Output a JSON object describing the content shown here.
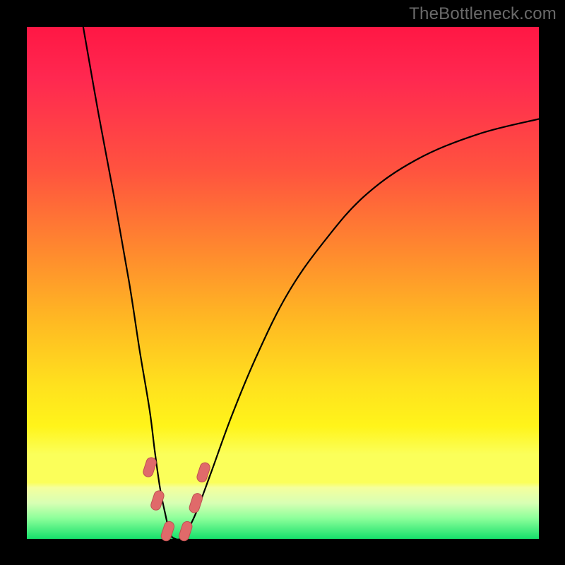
{
  "watermark": "TheBottleneck.com",
  "chart_data": {
    "type": "line",
    "title": "",
    "xlabel": "",
    "ylabel": "",
    "xlim": [
      0,
      100
    ],
    "ylim": [
      0,
      100
    ],
    "grid": false,
    "legend": false,
    "background": "red-yellow-green vertical gradient",
    "series": [
      {
        "name": "bottleneck-curve",
        "x": [
          11,
          14,
          17,
          20,
          22,
          24,
          25,
          26,
          27,
          28,
          29,
          30,
          31,
          33,
          36,
          40,
          45,
          51,
          58,
          66,
          76,
          88,
          100
        ],
        "y": [
          100,
          83,
          67,
          50,
          37,
          25,
          17,
          10,
          5,
          1,
          0,
          0,
          1,
          5,
          13,
          24,
          36,
          48,
          58,
          67,
          74,
          79,
          82
        ]
      }
    ],
    "annotations": [
      {
        "name": "nodule",
        "x": 24.0,
        "y": 14.0
      },
      {
        "name": "nodule",
        "x": 25.5,
        "y": 7.5
      },
      {
        "name": "nodule",
        "x": 27.5,
        "y": 1.5
      },
      {
        "name": "nodule",
        "x": 31.0,
        "y": 1.5
      },
      {
        "name": "nodule",
        "x": 33.0,
        "y": 7.0
      },
      {
        "name": "nodule",
        "x": 34.5,
        "y": 13.0
      }
    ],
    "colors": {
      "curve": "#000000",
      "nodule_fill": "#e06a6a",
      "gradient_top": "#ff1744",
      "gradient_mid": "#ffe11e",
      "gradient_bottom": "#16e06b"
    }
  }
}
